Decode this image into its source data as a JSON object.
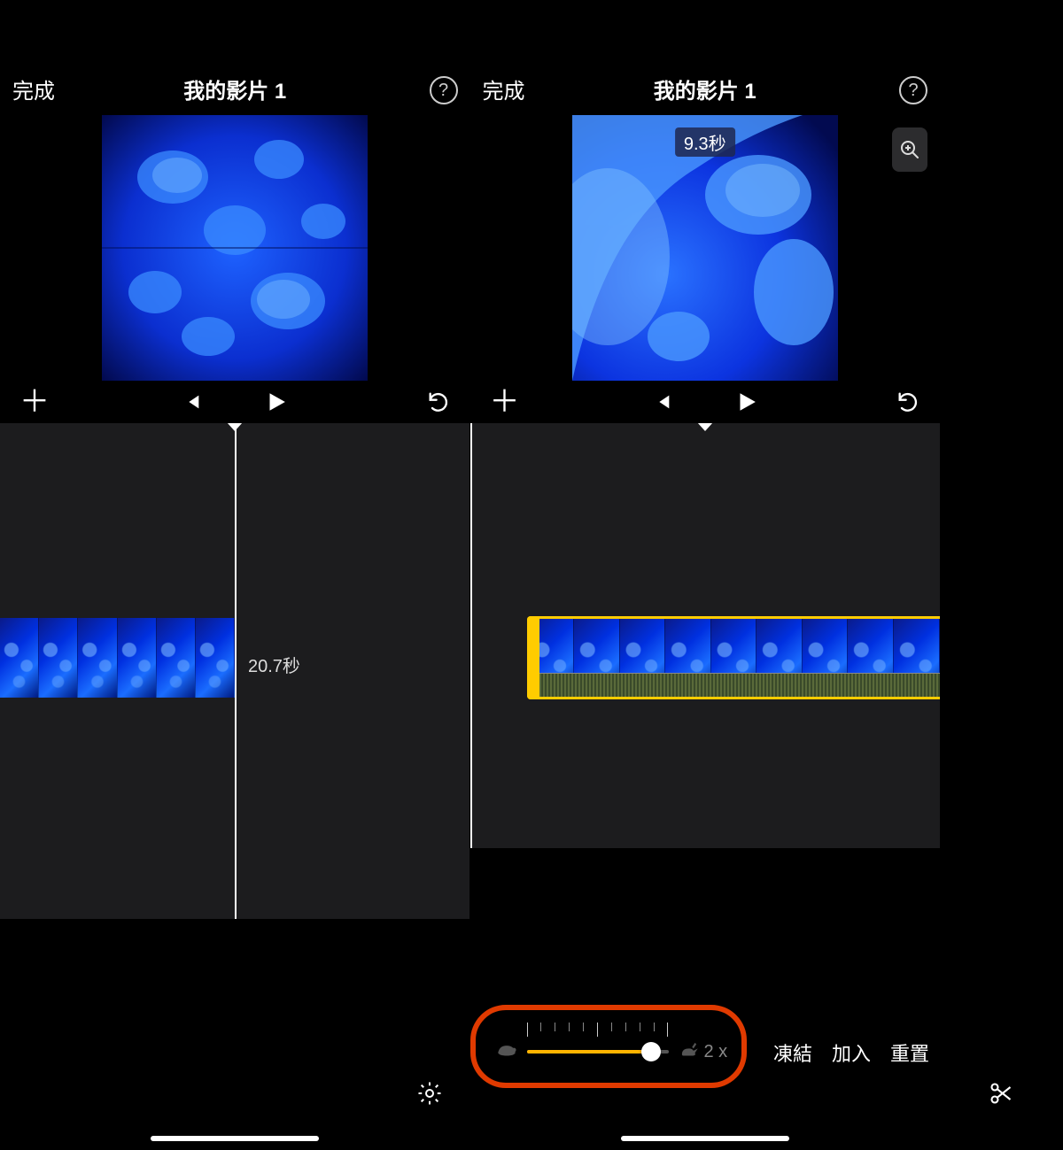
{
  "left": {
    "done": "完成",
    "title": "我的影片 1",
    "duration_label": "20.7秒"
  },
  "right": {
    "done": "完成",
    "title": "我的影片 1",
    "badge": "9.3秒",
    "speed_value": "2 x",
    "slider_percent": 88,
    "actions": {
      "freeze": "凍結",
      "add": "加入",
      "reset": "重置"
    }
  },
  "toolbar": {
    "items": [
      "settings",
      "cut",
      "speed",
      "volume",
      "text",
      "filters"
    ],
    "active": "speed"
  }
}
